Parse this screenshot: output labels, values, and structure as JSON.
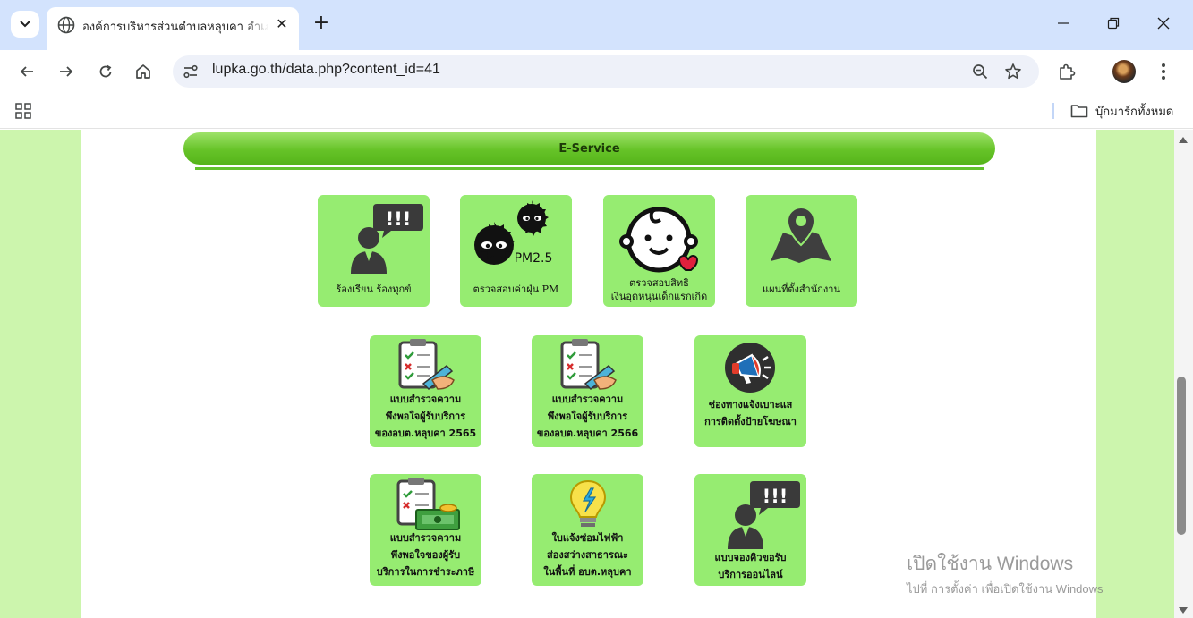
{
  "browser": {
    "tab": {
      "title": "องค์การบริหารส่วนตำบลหลุบคา อำเภ",
      "favicon": "globe-icon"
    },
    "url": "lupka.go.th/data.php?content_id=41",
    "bookmarks": {
      "all_bookmarks_label": "บุ๊กมาร์กทั้งหมด"
    }
  },
  "page": {
    "section_title": "E-Service",
    "services": [
      {
        "label": "ร้องเรียน ร้องทุกข์",
        "icon": "complaint-person-icon"
      },
      {
        "label": "ตรวจสอบค่าฝุ่น PM",
        "icon": "pm25-dust-icon",
        "icon_text": "PM2.5"
      },
      {
        "label": "ตรวจสอบสิทธิ\nเงินอุดหนุนเด็กแรกเกิด",
        "icon": "baby-face-icon"
      },
      {
        "label": "แผนที่ตั้งสำนักงาน",
        "icon": "map-pin-icon"
      },
      {
        "label": "แบบสำรวจความ\nพึงพอใจผู้รับบริการ\nของอบต.หลุบคา 2565",
        "icon": "survey-clipboard-icon"
      },
      {
        "label": "แบบสำรวจความ\nพึงพอใจผู้รับบริการ\nของอบต.หลุบคา 2566",
        "icon": "survey-clipboard-icon"
      },
      {
        "label": "ช่องทางแจ้งเบาะแส\nการติดตั้งป้ายโฆษณา",
        "icon": "megaphone-icon"
      },
      {
        "label": "แบบสำรวจความ\nพึงพอใจของผู้รับ\nบริการในการชำระภาษี",
        "icon": "tax-survey-icon"
      },
      {
        "label": "ใบแจ้งซ่อมไฟฟ้า\nส่องสว่างสาธารณะ\nในพื้นที่ อบต.หลุบคา",
        "icon": "lightbulb-icon"
      },
      {
        "label": "แบบจองคิวขอรับ\nบริการออนไลน์",
        "icon": "booking-person-icon"
      }
    ]
  },
  "watermark": {
    "title": "เปิดใช้งาน Windows",
    "subtitle": "ไปที่ การตั้งค่า เพื่อเปิดใช้งาน Windows"
  },
  "colors": {
    "tile": "#96ec71",
    "side_panel": "#ccf5ad",
    "banner": "#66c328"
  }
}
